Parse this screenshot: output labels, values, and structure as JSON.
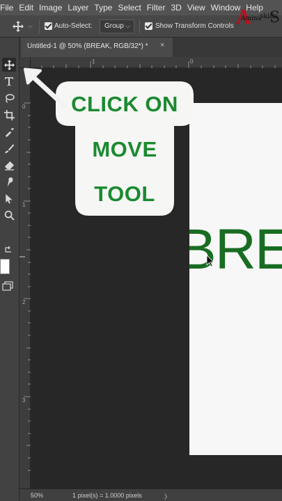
{
  "menubar": {
    "items": [
      "File",
      "Edit",
      "Image",
      "Layer",
      "Type",
      "Select",
      "Filter",
      "3D",
      "View",
      "Window",
      "Help"
    ]
  },
  "logo": {
    "letter": "A",
    "word1": "Amina",
    "word2": "skills",
    "s": "S"
  },
  "options": {
    "auto_select_label": "Auto-Select:",
    "group_value": "Group",
    "transform_label": "Show Transform Controls"
  },
  "tab": {
    "title": "Untitled-1 @ 50% (BREAK, RGB/32*) *",
    "close": "×"
  },
  "ruler": {
    "h_labels": [
      "1",
      "0"
    ],
    "v_labels": [
      "0",
      "1",
      "2",
      "3"
    ]
  },
  "canvas": {
    "doc_text": "BREAK"
  },
  "callout": {
    "line1": "CLICK ON",
    "line2": "MOVE",
    "line3": "TOOL"
  },
  "status": {
    "zoom": "50%",
    "info": "1 pixel(s) = 1.0000 pixels",
    "more": "〉"
  },
  "colors": {
    "accent_green": "#1b8a30",
    "text_green": "#186d22",
    "logo_red": "#b3121d"
  },
  "tools": [
    "move-icon",
    "type-icon",
    "lasso-icon",
    "crop-icon",
    "eyedropper-icon",
    "brush-icon",
    "eraser-icon",
    "smudge-icon",
    "path-selection-icon",
    "zoom-icon"
  ]
}
